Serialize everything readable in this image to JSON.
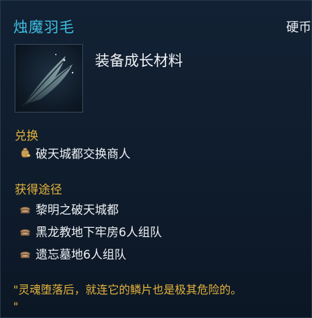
{
  "tooltip": {
    "item_name": "烛魔羽毛",
    "currency_label": "硬币",
    "item_type": "装备成长材料",
    "item_icon": "feather-icon"
  },
  "exchange": {
    "title": "兑换",
    "items": [
      {
        "label": "破天城都交换商人",
        "icon": "coin-pouch-icon"
      }
    ]
  },
  "acquire": {
    "title": "获得途径",
    "items": [
      {
        "label": "黎明之破天城都",
        "icon": "dungeon-icon"
      },
      {
        "label": "黑龙教地下牢房6人组队",
        "icon": "dungeon-icon"
      },
      {
        "label": "遗忘墓地6人组队",
        "icon": "dungeon-icon"
      }
    ]
  },
  "flavor_text": "\"灵魂堕落后，就连它的鳞片也是极其危险的。",
  "flavor_text_end": "\"",
  "colors": {
    "item_name": "#3ebfe3",
    "section_title": "#e2b23c",
    "flavor": "#e2b23c",
    "body_text": "#eef1f4",
    "background": "#122134"
  }
}
